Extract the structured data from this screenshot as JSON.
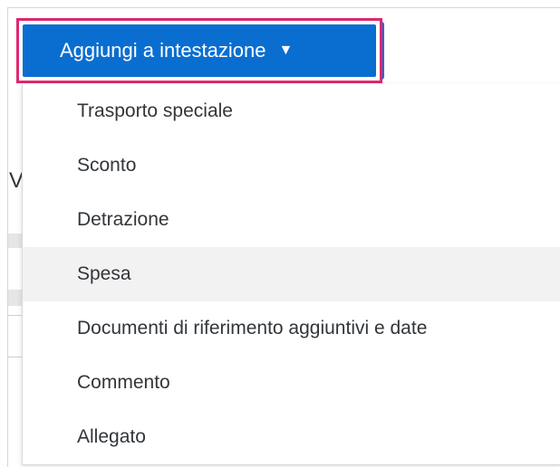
{
  "button": {
    "label": "Aggiungi a intestazione",
    "icon": "caret-down-icon",
    "color": "#0a6ed1",
    "highlight_color": "#e0266e"
  },
  "menu": {
    "items": [
      {
        "label": "Trasporto speciale"
      },
      {
        "label": "Sconto"
      },
      {
        "label": "Detrazione"
      },
      {
        "label": "Spesa"
      },
      {
        "label": "Documenti di riferimento aggiuntivi e date"
      },
      {
        "label": "Commento"
      },
      {
        "label": "Allegato"
      }
    ],
    "hovered_item": "Spesa"
  },
  "background": {
    "partial_char": "V"
  }
}
